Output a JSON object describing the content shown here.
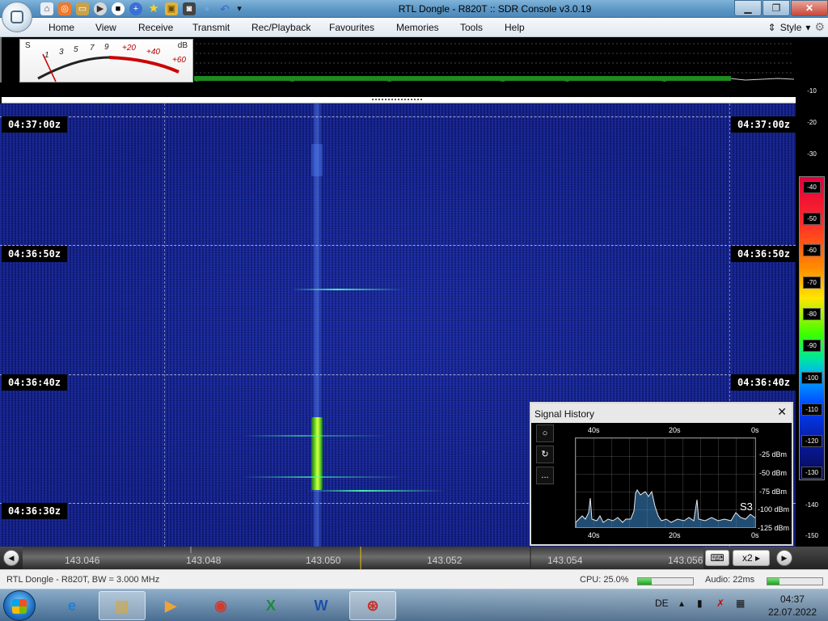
{
  "window": {
    "title": "RTL Dongle - R820T :: SDR Console v3.0.19"
  },
  "quick_access": [
    "home-icon",
    "lifebuoy-icon",
    "folder-icon",
    "play-icon",
    "stop-icon",
    "plus-icon",
    "star-icon",
    "lock-icon",
    "camera-icon",
    "drop-icon",
    "undo-icon",
    "dropdown-icon"
  ],
  "menu": [
    "Home",
    "View",
    "Receive",
    "Transmit",
    "Rec/Playback",
    "Favourites",
    "Memories",
    "Tools",
    "Help"
  ],
  "style_label": "Style",
  "smeter": {
    "s_label": "S",
    "db_label": "dB",
    "s_marks": [
      "1",
      "3",
      "5",
      "7",
      "9"
    ],
    "db_marks": [
      "+20",
      "+40",
      "+60"
    ]
  },
  "waterfall": {
    "time_labels": [
      "04:37:00z",
      "04:36:50z",
      "04:36:40z",
      "04:36:30z"
    ]
  },
  "db_scale": [
    "-10",
    "-20",
    "-30",
    "-40",
    "-50",
    "-60",
    "-70",
    "-80",
    "-90",
    "-100",
    "-110",
    "-120",
    "-130",
    "-140",
    "-150"
  ],
  "signal_history": {
    "title": "Signal History",
    "top_axis": [
      "40s",
      "20s",
      "0s"
    ],
    "bottom_axis": [
      "40s",
      "20s",
      "0s"
    ],
    "y_axis": [
      "-25 dBm",
      "-50 dBm",
      "-75 dBm",
      "-100 dBm",
      "-125 dBm"
    ],
    "s_reading": "S3",
    "buttons": [
      "record-icon",
      "reset-icon",
      "more-icon"
    ],
    "more_label": "..."
  },
  "frequency": {
    "labels": [
      "143.046",
      "143.048",
      "143.050",
      "143.052",
      "143.054",
      "143.056"
    ],
    "zoom": "x2"
  },
  "status": {
    "device": "RTL Dongle - R820T, BW = 3.000 MHz",
    "cpu": "CPU: 25.0%",
    "cpu_level": 0.25,
    "audio": "Audio: 22ms",
    "audio_level": 0.22
  },
  "taskbar": {
    "apps": [
      "internet-explorer-icon",
      "file-explorer-icon",
      "media-player-icon",
      "chrome-icon",
      "excel-icon",
      "word-icon",
      "sdr-console-icon"
    ],
    "lang": "DE",
    "time": "04:37",
    "date": "22.07.2022"
  }
}
